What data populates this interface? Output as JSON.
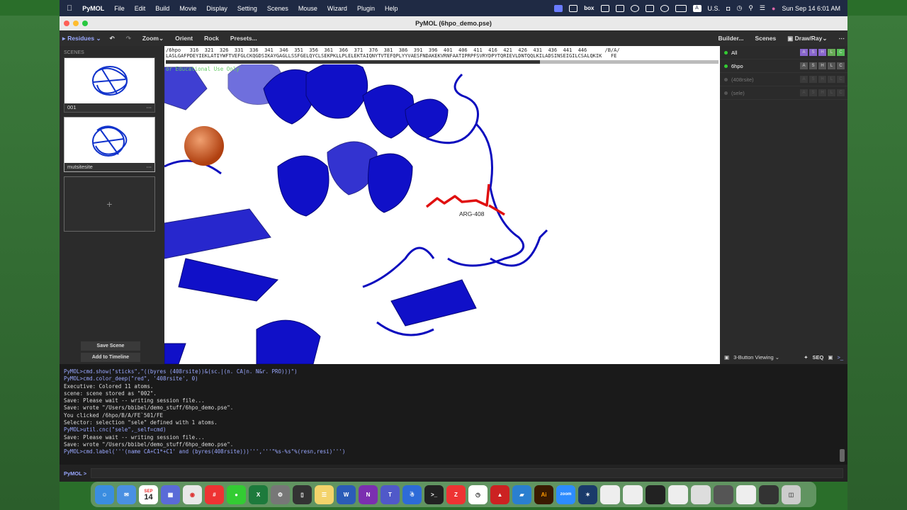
{
  "menubar": {
    "app": "PyMOL",
    "items": [
      "File",
      "Edit",
      "Build",
      "Movie",
      "Display",
      "Setting",
      "Scenes",
      "Mouse",
      "Wizard",
      "Plugin",
      "Help"
    ],
    "input_source": "U.S.",
    "datetime": "Sun Sep 14  6:01 AM"
  },
  "window": {
    "title": "PyMOL (6hpo_demo.pse)"
  },
  "toolbar": {
    "residues": "Residues",
    "zoom": "Zoom",
    "orient": "Orient",
    "rock": "Rock",
    "presets": "Presets...",
    "builder": "Builder...",
    "scenes": "Scenes",
    "drawray": "Draw/Ray"
  },
  "scenes": {
    "header": "SCENES",
    "items": [
      {
        "name": "001"
      },
      {
        "name": "mutsitesite"
      }
    ],
    "add": "+",
    "save": "Save Scene",
    "timeline": "Add to Timeline"
  },
  "sequence": {
    "line1": "/6hpo   316  321  326  331  336  341  346  351  356  361  366  371  376  381  386  391  396  401  406  411  416  421  426  431  436  441  446      /B/A/",
    "line2": "LASLGAFPDEYIEKLATIYWFTVEFGLCKQGDSIKAYGAGLLSSFGELQYCLSEKPKLLPLELEKTAIQNYTVTEFQPLYYVAESFNDAKEKVRNFAATIPRPFSVRYDPYTQRIEVLDNTQQLKILADSINSEIGILCSALQKIK   FE",
    "watermark": "or Educational Use Only"
  },
  "viewer": {
    "residue_label": "ARG-408"
  },
  "objects": [
    {
      "name": "All",
      "enabled": true
    },
    {
      "name": "6hpo",
      "enabled": true
    },
    {
      "name": "(408rsite)",
      "enabled": false
    },
    {
      "name": "(sele)",
      "enabled": false
    }
  ],
  "object_buttons": [
    "A",
    "S",
    "H",
    "L",
    "C"
  ],
  "bottom": {
    "mouse_mode": "3-Button Viewing",
    "seq": "SEQ"
  },
  "console": {
    "lines": [
      {
        "t": "PyMOL>cmd.show(\"sticks\",\"((byres (408rsite))&(sc.|(n. CA|n. N&r. PRO)))\")",
        "cmd": true
      },
      {
        "t": "PyMOL>cmd.color_deep(\"red\", '408rsite', 0)",
        "cmd": true
      },
      {
        "t": " Executive: Colored 11 atoms.",
        "cmd": false
      },
      {
        "t": " scene: scene stored as \"002\".",
        "cmd": false
      },
      {
        "t": " Save: Please wait -- writing session file...",
        "cmd": false
      },
      {
        "t": " Save: wrote \"/Users/bbibel/demo_stuff/6hpo_demo.pse\".",
        "cmd": false
      },
      {
        "t": " You clicked /6hpo/B/A/FE`501/FE",
        "cmd": false
      },
      {
        "t": " Selector: selection \"sele\" defined with 1 atoms.",
        "cmd": false
      },
      {
        "t": "PyMOL>util.cnc(\"sele\",_self=cmd)",
        "cmd": true
      },
      {
        "t": " Save: Please wait -- writing session file...",
        "cmd": false
      },
      {
        "t": " Save: wrote \"/Users/bbibel/demo_stuff/6hpo_demo.pse\".",
        "cmd": false
      },
      {
        "t": "PyMOL>cmd.label('''(name CA+C1*+C1' and (byres(408rsite)))''','''\"%s-%s\"%(resn,resi)''')",
        "cmd": true
      }
    ],
    "prompt": "PyMOL >"
  },
  "dock": {
    "calendar_day": "14",
    "calendar_month": "SEP"
  }
}
